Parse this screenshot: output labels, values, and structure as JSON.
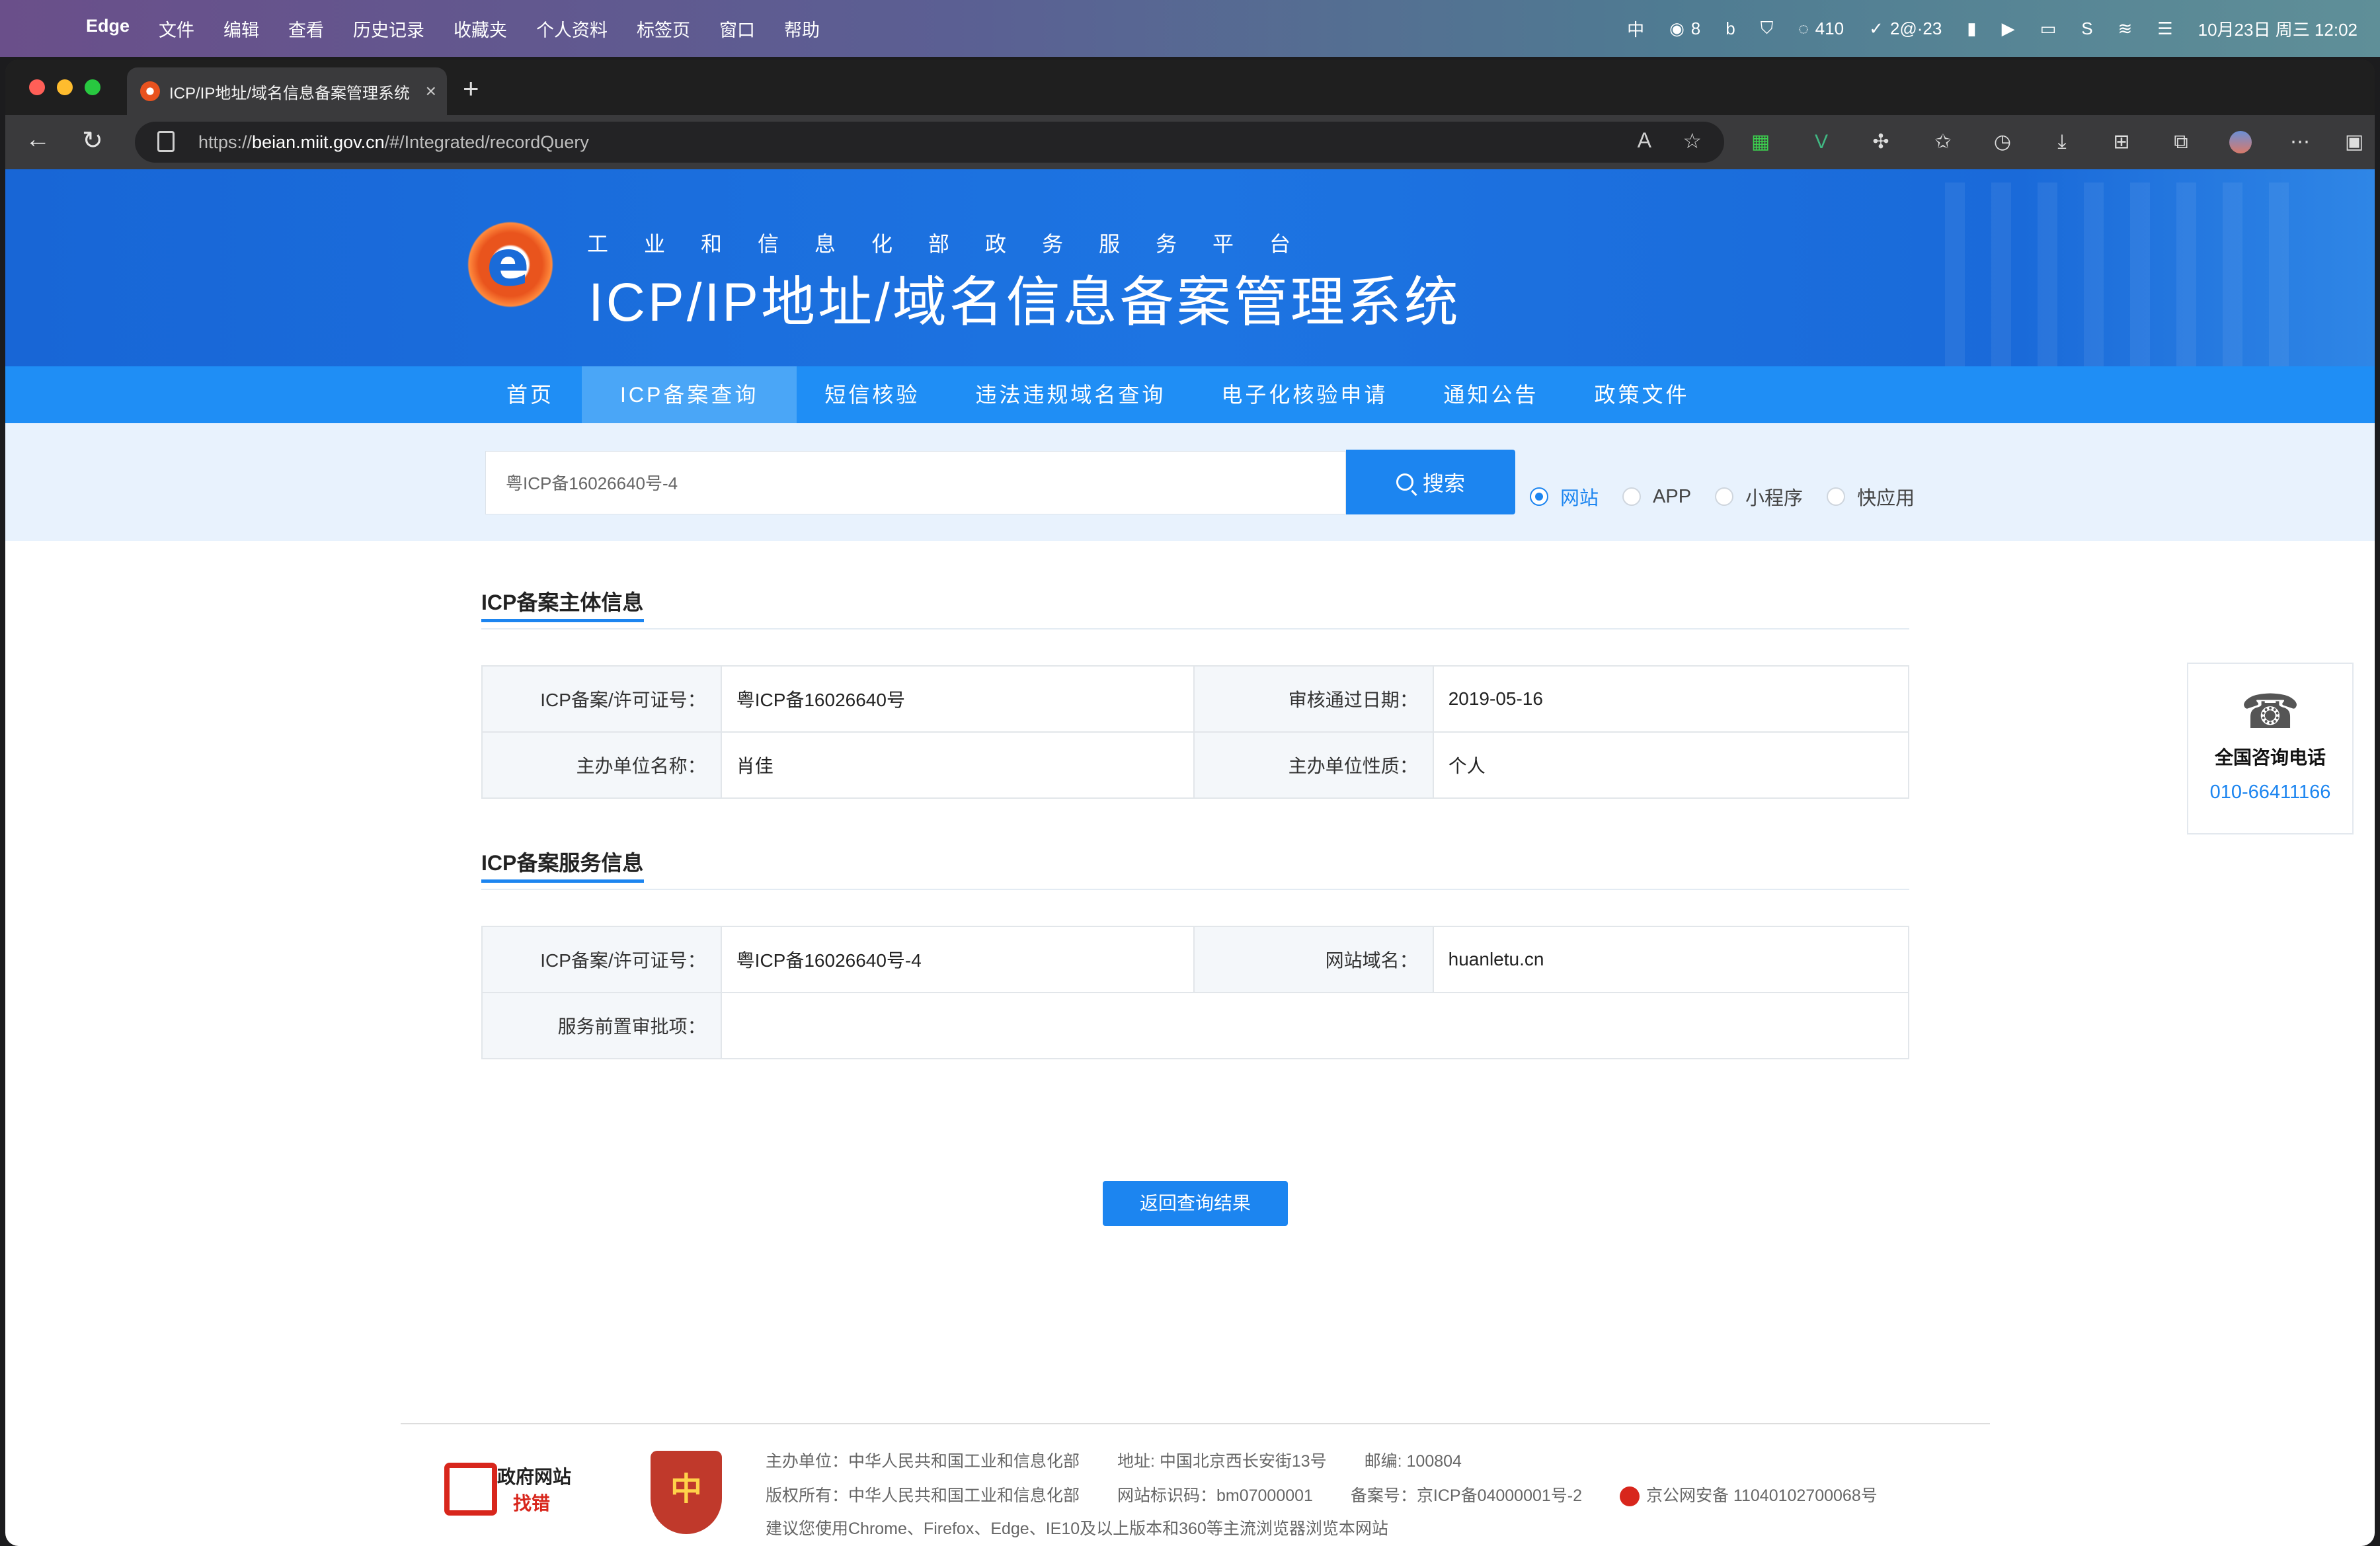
{
  "menubar": {
    "app": "Edge",
    "items": [
      "文件",
      "编辑",
      "查看",
      "历史记录",
      "收藏夹",
      "个人资料",
      "标签页",
      "窗口",
      "帮助"
    ],
    "wechat_count": "8",
    "chat_count": "410",
    "task_label": "2@·23",
    "datetime": "10月23日 周三  12:02"
  },
  "browser": {
    "tab_title": "ICP/IP地址/域名信息备案管理系统",
    "url_scheme": "https://",
    "url_domain": "beian.miit.gov.cn",
    "url_path": "/#/Integrated/recordQuery"
  },
  "header": {
    "subtitle": "工业和信息化部政务服务平台",
    "title": "ICP/IP地址/域名信息备案管理系统"
  },
  "nav": {
    "items": [
      "首页",
      "ICP备案查询",
      "短信核验",
      "违法违规域名查询",
      "电子化核验申请",
      "通知公告",
      "政策文件"
    ],
    "active": "ICP备案查询"
  },
  "search": {
    "value": "粤ICP备16026640号-4",
    "button": "搜索",
    "types": [
      "网站",
      "APP",
      "小程序",
      "快应用"
    ],
    "selected": "网站"
  },
  "subject": {
    "title": "ICP备案主体信息",
    "rows": [
      {
        "k1": "ICP备案/许可证号：",
        "v1": "粤ICP备16026640号",
        "k2": "审核通过日期：",
        "v2": "2019-05-16"
      },
      {
        "k1": "主办单位名称：",
        "v1": "肖佳",
        "k2": "主办单位性质：",
        "v2": "个人"
      }
    ]
  },
  "service": {
    "title": "ICP备案服务信息",
    "row1": {
      "k1": "ICP备案/许可证号：",
      "v1": "粤ICP备16026640号-4",
      "k2": "网站域名：",
      "v2": "huanletu.cn"
    },
    "row2": {
      "k1": "服务前置审批项：",
      "v1": ""
    }
  },
  "back_button": "返回查询结果",
  "consult": {
    "label": "全国咨询电话",
    "phone": "010-66411166"
  },
  "footer": {
    "gov_badge_line1": "政府网站",
    "gov_badge_line2": "找错",
    "sponsor": "主办单位：中华人民共和国工业和信息化部",
    "address": "地址: 中国北京西长安街13号",
    "postcode": "邮编: 100804",
    "copyright": "版权所有：中华人民共和国工业和信息化部",
    "site_id": "网站标识码：bm07000001",
    "icp": "备案号：京ICP备04000001号-2",
    "police": "京公网安备 11040102700068号",
    "browser_tip": "建议您使用Chrome、Firefox、Edge、IE10及以上版本和360等主流浏览器浏览本网站"
  }
}
